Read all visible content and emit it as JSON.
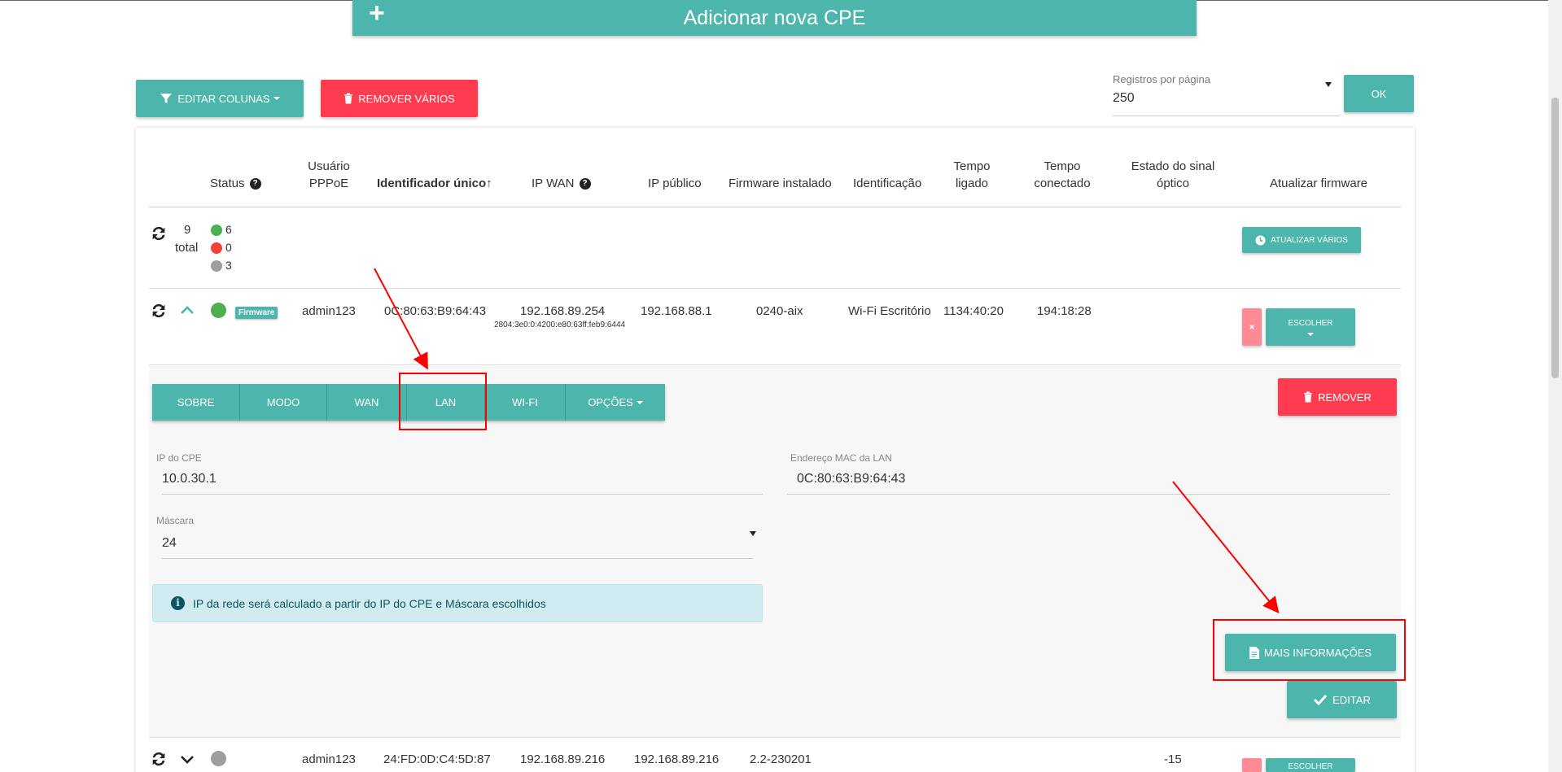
{
  "header": {
    "add_cpe_label": "Adicionar nova CPE"
  },
  "toolbar": {
    "edit_columns_label": "EDITAR COLUNAS",
    "remove_many_label": "REMOVER VÁRIOS",
    "per_page_label": "Registros por página",
    "per_page_value": "250",
    "ok_label": "OK"
  },
  "table": {
    "headers": {
      "status": "Status",
      "pppoe_1": "Usuário",
      "pppoe_2": "PPPoE",
      "unique_id": "Identificador único↑",
      "ip_wan": "IP WAN",
      "ip_public": "IP público",
      "firmware": "Firmware instalado",
      "identification": "Identificação",
      "uptime_1": "Tempo",
      "uptime_2": "ligado",
      "connected_1": "Tempo",
      "connected_2": "conectado",
      "optical_1": "Estado do sinal",
      "optical_2": "óptico",
      "update_fw": "Atualizar firmware"
    },
    "summary": {
      "total_count": "9",
      "total_label": "total",
      "green": "6",
      "red": "0",
      "gray": "3",
      "update_many_label": "ATUALIZAR VÁRIOS"
    },
    "rows": [
      {
        "badge": "Firmware",
        "pppoe": "admin123",
        "unique_id": "0C:80:63:B9:64:43",
        "ip_wan": "192.168.89.254",
        "ip_wan_v6": "2804:3e0:0:4200:e80:63ff:feb9:6444",
        "ip_public": "192.168.88.1",
        "firmware": "0240-aix",
        "identification": "Wi-Fi Escritório",
        "uptime": "1134:40:20",
        "connected": "194:18:28",
        "choose_label": "ESCOLHER",
        "close_label": "×"
      },
      {
        "pppoe": "admin123",
        "unique_id": "24:FD:0D:C4:5D:87",
        "ip_wan": "192.168.89.216",
        "ip_public": "192.168.89.216",
        "firmware": "2.2-230201",
        "optical": "-15",
        "choose_label": "ESCOLHER"
      }
    ]
  },
  "detail": {
    "tabs": [
      "SOBRE",
      "MODO",
      "WAN",
      "LAN",
      "WI-FI",
      "OPÇÕES"
    ],
    "active_tab": "LAN",
    "remove_label": "REMOVER",
    "cpe_ip_label": "IP do CPE",
    "cpe_ip_value": "10.0.30.1",
    "mac_label": "Endereço MAC da LAN",
    "mac_value": "0C:80:63:B9:64:43",
    "mask_label": "Máscara",
    "mask_value": "24",
    "alert_text": "IP da rede será calculado a partir do IP do CPE e Máscara escolhidos",
    "more_info_label": "MAIS INFORMAÇÕES",
    "edit_label": "EDITAR"
  },
  "colors": {
    "teal": "#4db6ac",
    "red": "#ff3b50",
    "active_tab": "#2e6b60",
    "status_green": "#4caf50",
    "status_red": "#f44336",
    "status_gray": "#9e9e9e",
    "annotation": "#ff0000"
  }
}
